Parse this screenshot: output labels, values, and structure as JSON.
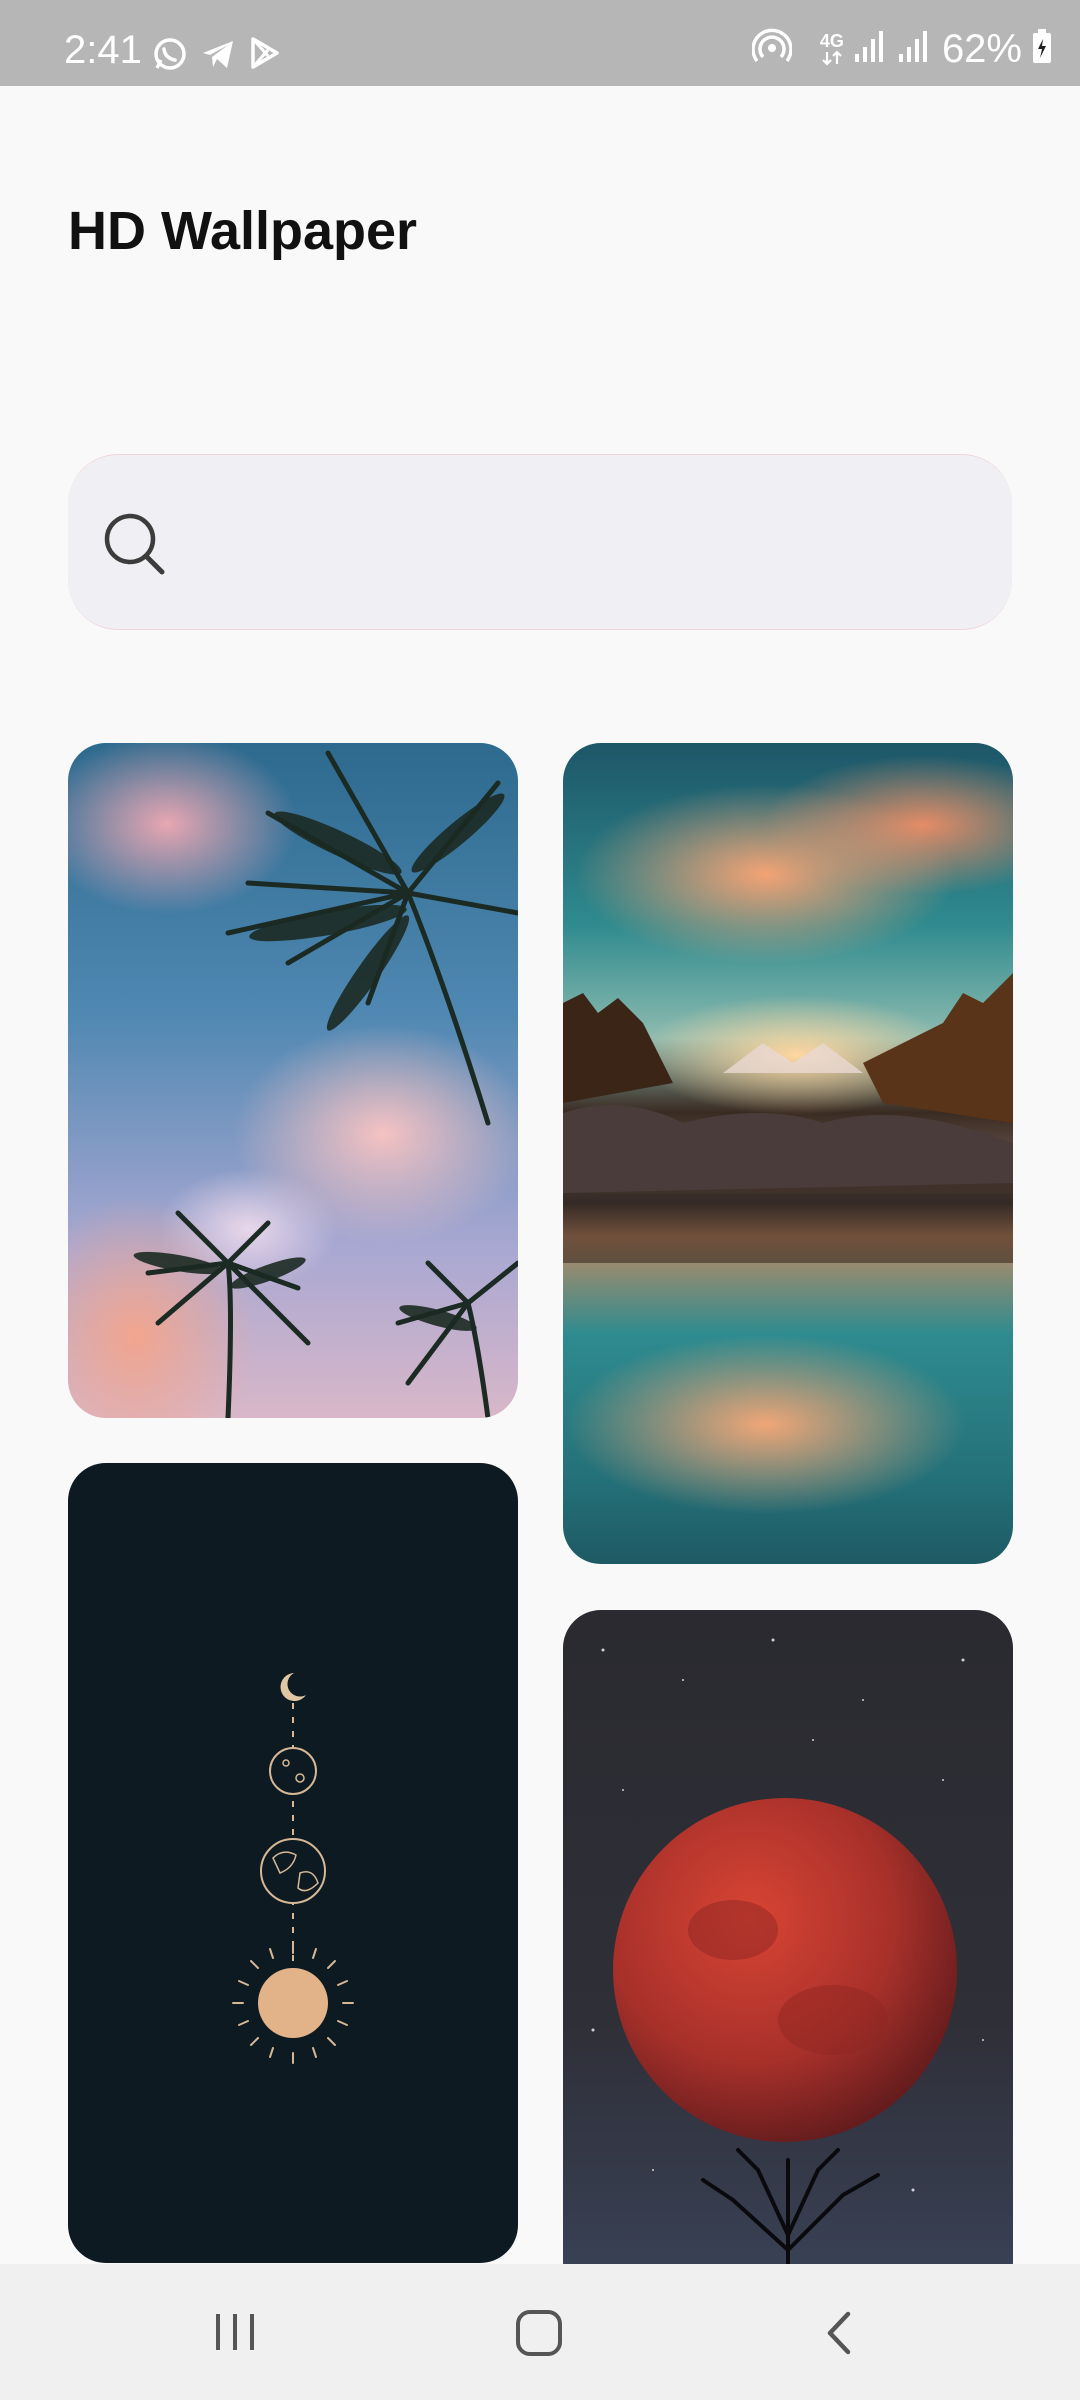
{
  "status_bar": {
    "time": "2:41",
    "network": "4G",
    "battery": "62%",
    "icons": [
      "whatsapp-icon",
      "telegram-icon",
      "play-store-icon",
      "hotspot-icon",
      "network-4g-icon",
      "signal-icon",
      "signal-icon",
      "battery-icon"
    ]
  },
  "header": {
    "title": "HD Wallpaper"
  },
  "search": {
    "placeholder": "",
    "value": "",
    "icon": "search-icon"
  },
  "wallpapers": [
    {
      "subject": "palm trees against pink-clouded blue sky"
    },
    {
      "subject": "sunset lake reflection with mountains"
    },
    {
      "subject": "moon phases, earth and sun line art on dark background"
    },
    {
      "subject": "red moon over silhouetted tree at night"
    }
  ],
  "nav_bar": {
    "icons": [
      "recent-apps-icon",
      "home-icon",
      "back-icon"
    ]
  },
  "colors": {
    "status_bar": "#b6b6b6",
    "background": "#f9f9f9",
    "search_bg": "#f0eff4",
    "nav_bar": "#f0f0f0"
  }
}
